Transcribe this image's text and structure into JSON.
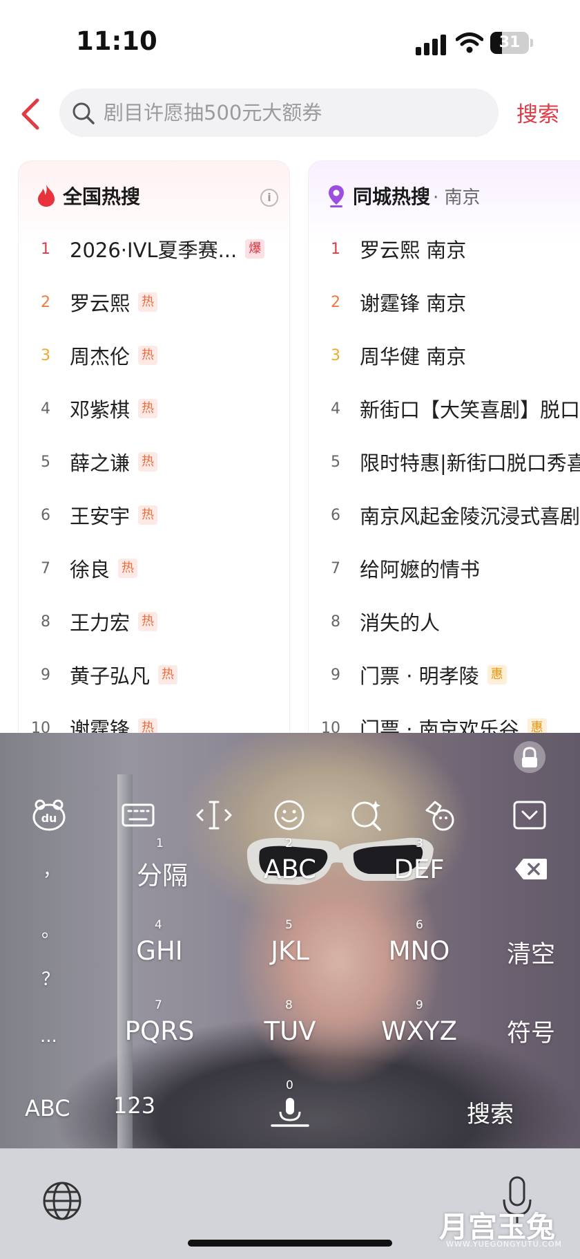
{
  "status_bar": {
    "time": "11:10",
    "battery": "31",
    "battery_level": 0.31
  },
  "search": {
    "placeholder": "剧目许愿抽500元大额券",
    "button_label": "搜索"
  },
  "national_hot": {
    "title": "全国热搜",
    "items": [
      {
        "rank": "1",
        "text": "2026·IVL夏季赛...",
        "tag": "爆"
      },
      {
        "rank": "2",
        "text": "罗云熙",
        "tag": "热"
      },
      {
        "rank": "3",
        "text": "周杰伦",
        "tag": "热"
      },
      {
        "rank": "4",
        "text": "邓紫棋",
        "tag": "热"
      },
      {
        "rank": "5",
        "text": "薛之谦",
        "tag": "热"
      },
      {
        "rank": "6",
        "text": "王安宇",
        "tag": "热"
      },
      {
        "rank": "7",
        "text": "徐良",
        "tag": "热"
      },
      {
        "rank": "8",
        "text": "王力宏",
        "tag": "热"
      },
      {
        "rank": "9",
        "text": "黄子弘凡",
        "tag": "热"
      },
      {
        "rank": "10",
        "text": "谢霆锋",
        "tag": "热"
      }
    ]
  },
  "city_hot": {
    "title": "同城热搜",
    "city": "· 南京",
    "items": [
      {
        "rank": "1",
        "text": "罗云熙 南京",
        "tag": ""
      },
      {
        "rank": "2",
        "text": "谢霆锋 南京",
        "tag": ""
      },
      {
        "rank": "3",
        "text": "周华健 南京",
        "tag": ""
      },
      {
        "rank": "4",
        "text": "新街口【大笑喜剧】脱口",
        "tag": ""
      },
      {
        "rank": "5",
        "text": "限时特惠|新街口脱口秀喜",
        "tag": ""
      },
      {
        "rank": "6",
        "text": "南京风起金陵沉浸式喜剧",
        "tag": ""
      },
      {
        "rank": "7",
        "text": "给阿嬷的情书",
        "tag": ""
      },
      {
        "rank": "8",
        "text": "消失的人",
        "tag": ""
      },
      {
        "rank": "9",
        "text": "门票 · 明孝陵",
        "tag": "惠"
      },
      {
        "rank": "10",
        "text": "门票 · 南京欢乐谷",
        "tag": "惠"
      }
    ]
  },
  "keyboard": {
    "toolbar": [
      "du-logo-icon",
      "keyboard-icon",
      "cursor-icon",
      "emoji-icon",
      "search-sparkle-icon",
      "skin-icon",
      "collapse-icon"
    ],
    "punctuation": [
      "，",
      "。",
      "？",
      "..."
    ],
    "keys": [
      {
        "digit": "1",
        "label": "分隔"
      },
      {
        "digit": "2",
        "label": "ABC"
      },
      {
        "digit": "3",
        "label": "DEF"
      },
      {
        "digit": "4",
        "label": "GHI"
      },
      {
        "digit": "5",
        "label": "JKL"
      },
      {
        "digit": "6",
        "label": "MNO"
      },
      {
        "digit": "7",
        "label": "PQRS"
      },
      {
        "digit": "8",
        "label": "TUV"
      },
      {
        "digit": "9",
        "label": "WXYZ"
      },
      {
        "digit": "0",
        "label": ""
      }
    ],
    "clear_label": "清空",
    "symbol_label": "符号",
    "abc_label": "ABC",
    "num_label": "123",
    "search_label": "搜索"
  },
  "watermark": {
    "text": "月宫玉兔",
    "sub": "WWW.YUEGONGYUTU.COM"
  }
}
